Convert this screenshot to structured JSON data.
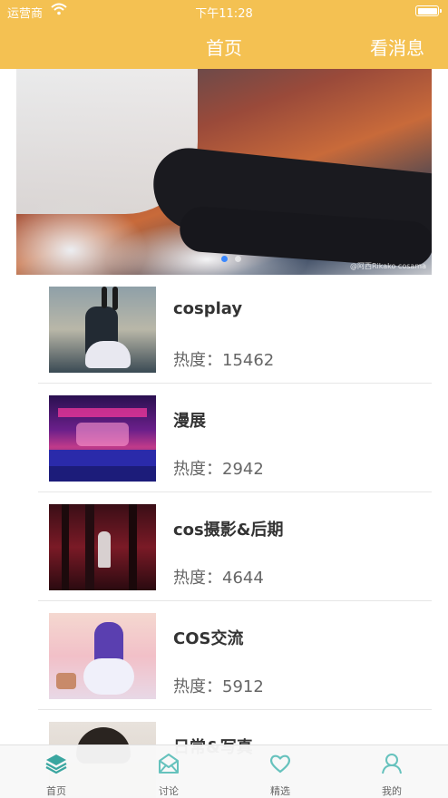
{
  "status_bar": {
    "carrier": "运营商",
    "time": "下午11:28"
  },
  "nav": {
    "title": "首页",
    "right_button": "看消息"
  },
  "banner": {
    "watermark": "@阿西Rikako cosama",
    "page_count": 2,
    "active_page": 1
  },
  "list": [
    {
      "name": "cosplay",
      "heat_label": "热度：",
      "heat_value": "15462"
    },
    {
      "name": "漫展",
      "heat_label": "热度：",
      "heat_value": "2942"
    },
    {
      "name": "cos摄影&后期",
      "heat_label": "热度：",
      "heat_value": "4644"
    },
    {
      "name": "COS交流",
      "heat_label": "热度：",
      "heat_value": "5912"
    },
    {
      "name": "日常&写真",
      "heat_label": "",
      "heat_value": ""
    }
  ],
  "tabs": [
    {
      "label": "首页",
      "icon": "layers-icon",
      "active": true
    },
    {
      "label": "讨论",
      "icon": "mail-icon",
      "active": false
    },
    {
      "label": "精选",
      "icon": "heart-icon",
      "active": false
    },
    {
      "label": "我的",
      "icon": "user-icon",
      "active": false
    }
  ],
  "colors": {
    "header": "#f4c152",
    "tab_icon_active": "#3aa6a0",
    "tab_icon": "#66c2bd",
    "banner_dot_active": "#3a88ff"
  }
}
